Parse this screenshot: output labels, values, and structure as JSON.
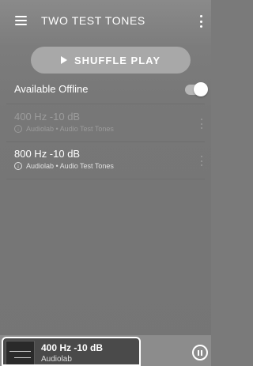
{
  "header": {
    "title": "TWO TEST TONES",
    "menu_icon": "hamburger-menu-icon",
    "overflow_icon": "more-vertical-icon"
  },
  "shuffle": {
    "label": "SHUFFLE PLAY",
    "icon": "play-icon"
  },
  "offline": {
    "label": "Available Offline",
    "enabled": true
  },
  "tracks": [
    {
      "title": "400 Hz -10 dB",
      "artist": "Audiolab",
      "album": "Audio Test Tones",
      "subtitle": "Audiolab • Audio Test Tones",
      "state": "playing"
    },
    {
      "title": "800 Hz -10 dB",
      "artist": "Audiolab",
      "album": "Audio Test Tones",
      "subtitle": "Audiolab • Audio Test Tones",
      "state": "idle"
    }
  ],
  "now_playing": {
    "title": "400 Hz -10 dB",
    "artist": "Audiolab",
    "control_icon": "pause-icon"
  },
  "colors": {
    "background": "#7a7a7a",
    "text": "#ffffff",
    "dim_text": "#9c9c9c",
    "button": "#a8a8a8"
  }
}
